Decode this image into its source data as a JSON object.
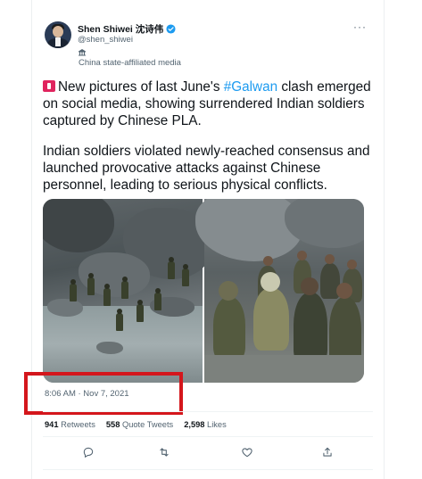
{
  "author": {
    "display_name": "Shen Shiwei 沈诗伟",
    "handle": "@shen_shiwei",
    "label": "China state-affiliated media",
    "avatar_icon": "user-avatar",
    "verified_icon": "verified-badge-icon",
    "verified_color": "#1d9bf0"
  },
  "more_label": "···",
  "tweet": {
    "p1_before": "New pictures of last June's ",
    "hashtag": "#Galwan",
    "p1_after": " clash emerged on social media, showing surrendered Indian soldiers captured by Chinese PLA.",
    "p2": "Indian soldiers violated newly-reached consensus and launched provocative attacks against Chinese personnel, leading to serious physical conflicts.",
    "emoji_icon": "siren-icon"
  },
  "timestamp": "8:06 AM · Nov 7, 2021",
  "stats": {
    "retweets_count": "941",
    "retweets_label": "Retweets",
    "quotes_count": "558",
    "quotes_label": "Quote Tweets",
    "likes_count": "2,598",
    "likes_label": "Likes"
  },
  "actions": [
    "reply-icon",
    "retweet-icon",
    "like-icon",
    "share-icon"
  ],
  "colors": {
    "accent": "#1d9bf0",
    "highlight": "#d4161c",
    "muted": "#536471"
  }
}
